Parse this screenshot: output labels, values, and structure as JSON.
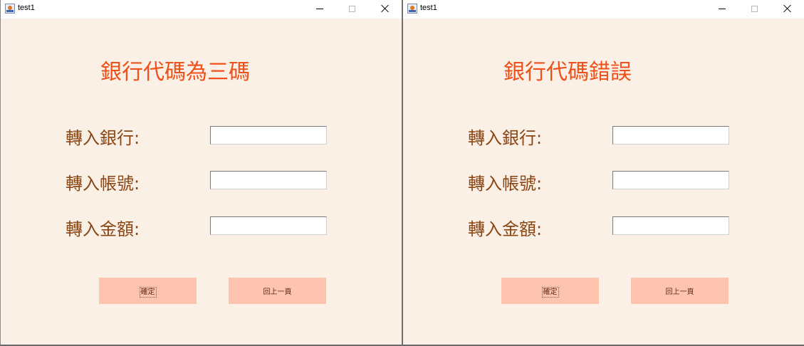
{
  "windows": [
    {
      "title": "test1",
      "heading": "銀行代碼為三碼",
      "fields": [
        {
          "label": "轉入銀行:",
          "value": ""
        },
        {
          "label": "轉入帳號:",
          "value": ""
        },
        {
          "label": "轉入金額:",
          "value": ""
        }
      ],
      "buttons": {
        "confirm": "確定",
        "back": "回上一頁"
      }
    },
    {
      "title": "test1",
      "heading": "銀行代碼錯誤",
      "fields": [
        {
          "label": "轉入銀行:",
          "value": ""
        },
        {
          "label": "轉入帳號:",
          "value": ""
        },
        {
          "label": "轉入金額:",
          "value": ""
        }
      ],
      "buttons": {
        "confirm": "確定",
        "back": "回上一頁"
      }
    }
  ],
  "colors": {
    "window_background": "#faf0e6",
    "heading": "#f0501a",
    "label": "#8b4513",
    "button_background": "#ffc4b0"
  },
  "icons": {
    "app": "java-cup-icon",
    "minimize": "minimize-icon",
    "maximize": "maximize-icon",
    "close": "close-icon"
  }
}
